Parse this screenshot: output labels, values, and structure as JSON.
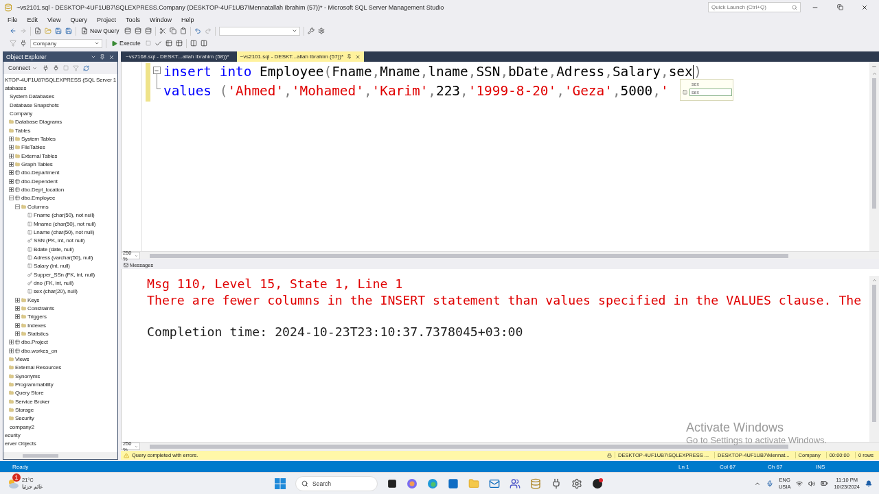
{
  "window": {
    "title": "~vs2101.sql - DESKTOP-4UF1UB7\\SQLEXPRESS.Company (DESKTOP-4UF1UB7\\Mennatallah Ibrahim (57))* - Microsoft SQL Server Management Studio",
    "quick_launch": {
      "placeholder": "Quick Launch (Ctrl+Q)"
    }
  },
  "menu": [
    "File",
    "Edit",
    "View",
    "Query",
    "Project",
    "Tools",
    "Window",
    "Help"
  ],
  "toolbar": {
    "new_query": "New Query",
    "database": "Company",
    "execute": "Execute"
  },
  "object_explorer": {
    "title": "Object Explorer",
    "connect": "Connect",
    "tree": [
      {
        "text": "KTOP-4UF1U87\\SQLEXPRESS (SQL Server 1",
        "children": [
          {
            "text": "atabases",
            "children": [
              {
                "text": "System Databases"
              },
              {
                "text": "Database Snapshots"
              },
              {
                "text": "Company",
                "children": [
                  {
                    "text": "Database Diagrams",
                    "kind": "folder"
                  },
                  {
                    "text": "Tables",
                    "kind": "folder",
                    "children": [
                      {
                        "text": "System Tables",
                        "kind": "folder",
                        "expanded": false
                      },
                      {
                        "text": "FileTables",
                        "kind": "folder",
                        "expanded": false
                      },
                      {
                        "text": "External Tables",
                        "kind": "folder",
                        "expanded": false
                      },
                      {
                        "text": "Graph Tables",
                        "kind": "folder",
                        "expanded": false
                      },
                      {
                        "text": "dbo.Department",
                        "kind": "table",
                        "expanded": false
                      },
                      {
                        "text": "dbo.Dependent",
                        "kind": "table",
                        "expanded": false
                      },
                      {
                        "text": "dbo.Dept_location",
                        "kind": "table",
                        "expanded": false
                      },
                      {
                        "text": "dbo.Employee",
                        "kind": "table",
                        "expanded": true,
                        "children": [
                          {
                            "text": "Columns",
                            "kind": "folder",
                            "expanded": true,
                            "children": [
                              {
                                "text": "Fname (char(50), not null)",
                                "kind": "column"
                              },
                              {
                                "text": "Mname (char(50), not null)",
                                "kind": "column"
                              },
                              {
                                "text": "Lname (char(50), not null)",
                                "kind": "column"
                              },
                              {
                                "text": "SSN (PK, int, not null)",
                                "kind": "key"
                              },
                              {
                                "text": "Bdate (date, null)",
                                "kind": "column"
                              },
                              {
                                "text": "Adress (varchar(50), null)",
                                "kind": "column"
                              },
                              {
                                "text": "Salary (int, null)",
                                "kind": "column"
                              },
                              {
                                "text": "Supper_SSn (FK, int, null)",
                                "kind": "key"
                              },
                              {
                                "text": "dno (FK, int, null)",
                                "kind": "key"
                              },
                              {
                                "text": "sex (char(20), null)",
                                "kind": "column"
                              }
                            ]
                          },
                          {
                            "text": "Keys",
                            "kind": "folder",
                            "expanded": false
                          },
                          {
                            "text": "Constraints",
                            "kind": "folder",
                            "expanded": false
                          },
                          {
                            "text": "Triggers",
                            "kind": "folder",
                            "expanded": false
                          },
                          {
                            "text": "Indexes",
                            "kind": "folder",
                            "expanded": false
                          },
                          {
                            "text": "Statistics",
                            "kind": "folder",
                            "expanded": false
                          }
                        ]
                      },
                      {
                        "text": "dbo.Project",
                        "kind": "table",
                        "expanded": false
                      },
                      {
                        "text": "dbo.workes_on",
                        "kind": "table",
                        "expanded": false
                      }
                    ]
                  },
                  {
                    "text": "Views",
                    "kind": "folder"
                  },
                  {
                    "text": "External Resources",
                    "kind": "folder"
                  },
                  {
                    "text": "Synonyms",
                    "kind": "folder"
                  },
                  {
                    "text": "Programmability",
                    "kind": "folder"
                  },
                  {
                    "text": "Query Store",
                    "kind": "folder"
                  },
                  {
                    "text": "Service Broker",
                    "kind": "folder"
                  },
                  {
                    "text": "Storage",
                    "kind": "folder"
                  },
                  {
                    "text": "Security",
                    "kind": "folder"
                  }
                ]
              },
              {
                "text": "company2"
              }
            ]
          },
          {
            "text": "ecurity"
          },
          {
            "text": "erver Objects"
          }
        ]
      }
    ]
  },
  "doc_tabs": [
    {
      "label": "~vs7168.sql - DESKT...allah Ibrahim (58))*",
      "selected": false
    },
    {
      "label": "~vs2101.sql - DESKT...allah Ibrahim (57))*",
      "selected": true
    }
  ],
  "editor": {
    "lines": [
      [
        {
          "kind": "keyword",
          "text": "insert into"
        },
        {
          "kind": "ident",
          "text": " Employee"
        },
        {
          "kind": "punct",
          "text": "("
        },
        {
          "kind": "ident",
          "text": "Fname"
        },
        {
          "kind": "punct",
          "text": ","
        },
        {
          "kind": "ident",
          "text": "Mname"
        },
        {
          "kind": "punct",
          "text": ","
        },
        {
          "kind": "ident",
          "text": "lname"
        },
        {
          "kind": "punct",
          "text": ","
        },
        {
          "kind": "ident",
          "text": "SSN"
        },
        {
          "kind": "punct",
          "text": ","
        },
        {
          "kind": "ident",
          "text": "bDate"
        },
        {
          "kind": "punct",
          "text": ","
        },
        {
          "kind": "ident",
          "text": "Adress"
        },
        {
          "kind": "punct",
          "text": ","
        },
        {
          "kind": "ident",
          "text": "Salary"
        },
        {
          "kind": "punct",
          "text": ","
        },
        {
          "kind": "ident",
          "text": "sex"
        },
        {
          "kind": "punct",
          "text": ")"
        }
      ],
      [
        {
          "kind": "keyword",
          "text": "values"
        },
        {
          "kind": "punct",
          "text": " ("
        },
        {
          "kind": "string",
          "text": "'Ahmed'"
        },
        {
          "kind": "punct",
          "text": ","
        },
        {
          "kind": "string",
          "text": "'Mohamed'"
        },
        {
          "kind": "punct",
          "text": ","
        },
        {
          "kind": "string",
          "text": "'Karim'"
        },
        {
          "kind": "punct",
          "text": ","
        },
        {
          "kind": "ident",
          "text": "223"
        },
        {
          "kind": "punct",
          "text": ","
        },
        {
          "kind": "string",
          "text": "'1999-8-20'"
        },
        {
          "kind": "punct",
          "text": ","
        },
        {
          "kind": "string",
          "text": "'Geza'"
        },
        {
          "kind": "punct",
          "text": ","
        },
        {
          "kind": "ident",
          "text": "5000"
        },
        {
          "kind": "punct",
          "text": ","
        },
        {
          "kind": "string",
          "text": "'"
        }
      ]
    ],
    "completion": {
      "header": "sex",
      "item": "sex"
    },
    "zoom": "250 %"
  },
  "messages": {
    "tab": "Messages",
    "lines": [
      {
        "kind": "error",
        "text": "Msg 110, Level 15, State 1, Line 1"
      },
      {
        "kind": "error",
        "text": "There are fewer columns in the INSERT statement than values specified in the VALUES clause. The"
      },
      {
        "kind": "info",
        "text": "Completion time: 2024-10-23T23:10:37.7378045+03:00"
      }
    ],
    "zoom": "250 %"
  },
  "activation": {
    "title": "Activate Windows",
    "hint": "Go to Settings to activate Windows."
  },
  "query_status": {
    "message": "Query completed with errors.",
    "items": [
      "DESKTOP-4UF1UB7\\SQLEXPRESS ...",
      "DESKTOP-4UF1UB7\\Mennat...",
      "Company",
      "00:00:00",
      "0 rows"
    ]
  },
  "status_bar": {
    "state": "Ready",
    "items": [
      "Ln 1",
      "Col 67",
      "Ch 67",
      "INS"
    ]
  },
  "taskbar": {
    "weather": {
      "badge": "1",
      "temp": "21°C",
      "condition": "غائم جزئيا"
    },
    "search": {
      "placeholder": "Search"
    },
    "tray": {
      "lang": "ENG",
      "layout": "USIA",
      "time": "11:10 PM",
      "date": "10/23/2024"
    }
  }
}
